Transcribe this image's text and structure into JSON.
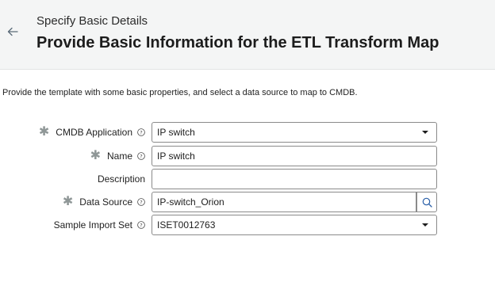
{
  "header": {
    "subtitle": "Specify Basic Details",
    "title": "Provide Basic Information for the ETL Transform Map"
  },
  "intro_text": "Provide the template with some basic properties, and select a data source to map to CMDB.",
  "form": {
    "cmdb_application": {
      "label": "CMDB Application",
      "value": "IP switch",
      "required": true
    },
    "name": {
      "label": "Name",
      "value": "IP switch",
      "required": true
    },
    "description": {
      "label": "Description",
      "value": "",
      "required": false
    },
    "data_source": {
      "label": "Data Source",
      "value": "IP-switch_Orion",
      "required": true
    },
    "sample_import_set": {
      "label": "Sample Import Set",
      "value": "ISET0012763",
      "required": false
    }
  },
  "icons": {
    "back": "arrow-left-icon",
    "help": "help-circle-icon",
    "dropdown": "caret-down-icon",
    "lookup": "search-icon",
    "required": "asterisk-icon"
  },
  "colors": {
    "header_bg": "#f4f5f5",
    "border": "#8a8a8a",
    "required_marker": "#8f9797",
    "text": "#1d1d1d"
  }
}
